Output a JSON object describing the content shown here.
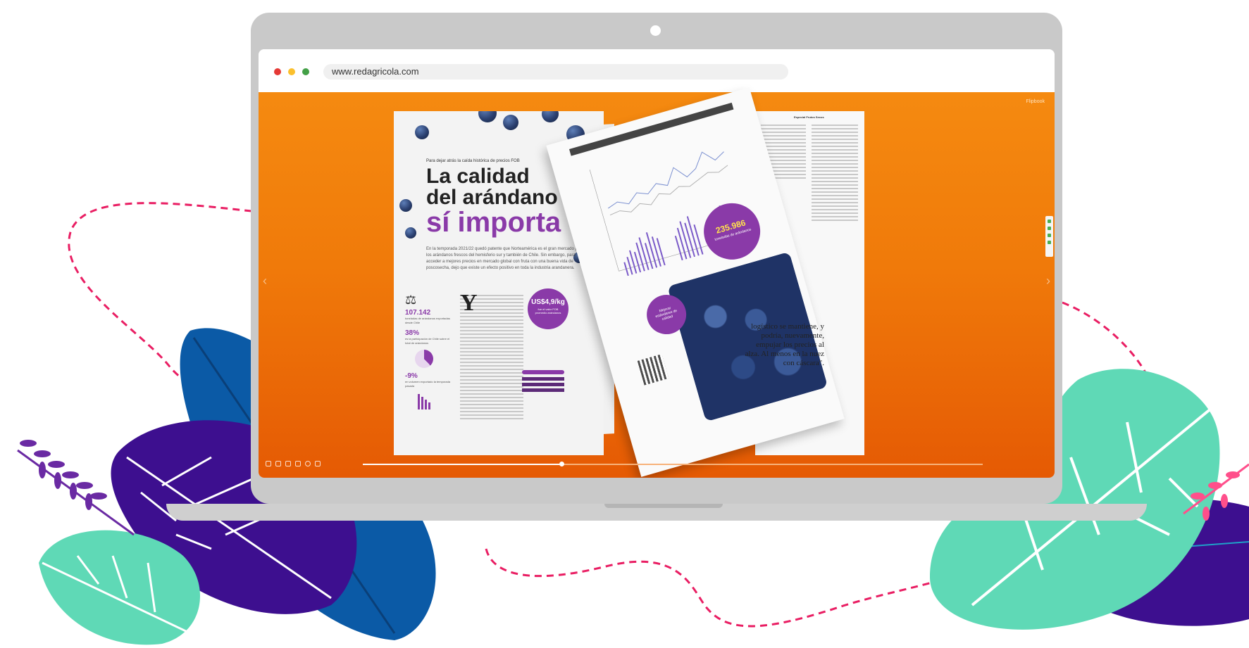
{
  "browser": {
    "url": "www.redagricola.com",
    "dots": {
      "red": "#e53935",
      "yellow": "#fbc02d",
      "green": "#43a047"
    }
  },
  "viewer": {
    "bg_color": "#f07a0a",
    "logo": "Flipbook",
    "progress_fraction": 0.32
  },
  "magazine": {
    "left_page": {
      "kicker": "Para dejar atrás la caída histórica de precios FOB",
      "headline": [
        "La calidad",
        "del arándano",
        "sí importa"
      ],
      "lede": "En la temporada 2021/22 quedó patente que Norteamérica es el gran mercado para los arándanos frescos del hemisferio sur y también de Chile. Sin embargo, para acceder a mejores precios en mercado global con fruta con una buena vida de poscosecha, dejo que existe un efecto positivo en toda la industria arandanera.",
      "stats": [
        {
          "value": "107.142",
          "text": "toneladas de arándanos exportadas desde Chile"
        },
        {
          "value": "38%",
          "text": "es la participación de Chile sobre el total de arándanos"
        },
        {
          "value": "-9%",
          "text": "en volumen exportado la temporada pasada"
        }
      ],
      "dropcap": "Y",
      "price": {
        "main": "US$4,9/kg",
        "sub": "fue el valor FOB promedio arándanos"
      }
    },
    "flip_page": {
      "circle_top": {
        "num": "235.986",
        "text": "toneladas de arándanos"
      },
      "circle_left": {
        "text": "Mejorar estándares de calidad"
      }
    },
    "right_page": {
      "header": "Especial Frutos Secos",
      "quote": "logístico se mantiene, y podría, nuevamente, empujar los precios al alza. Al menos en la nuez con cáscara\"."
    }
  }
}
